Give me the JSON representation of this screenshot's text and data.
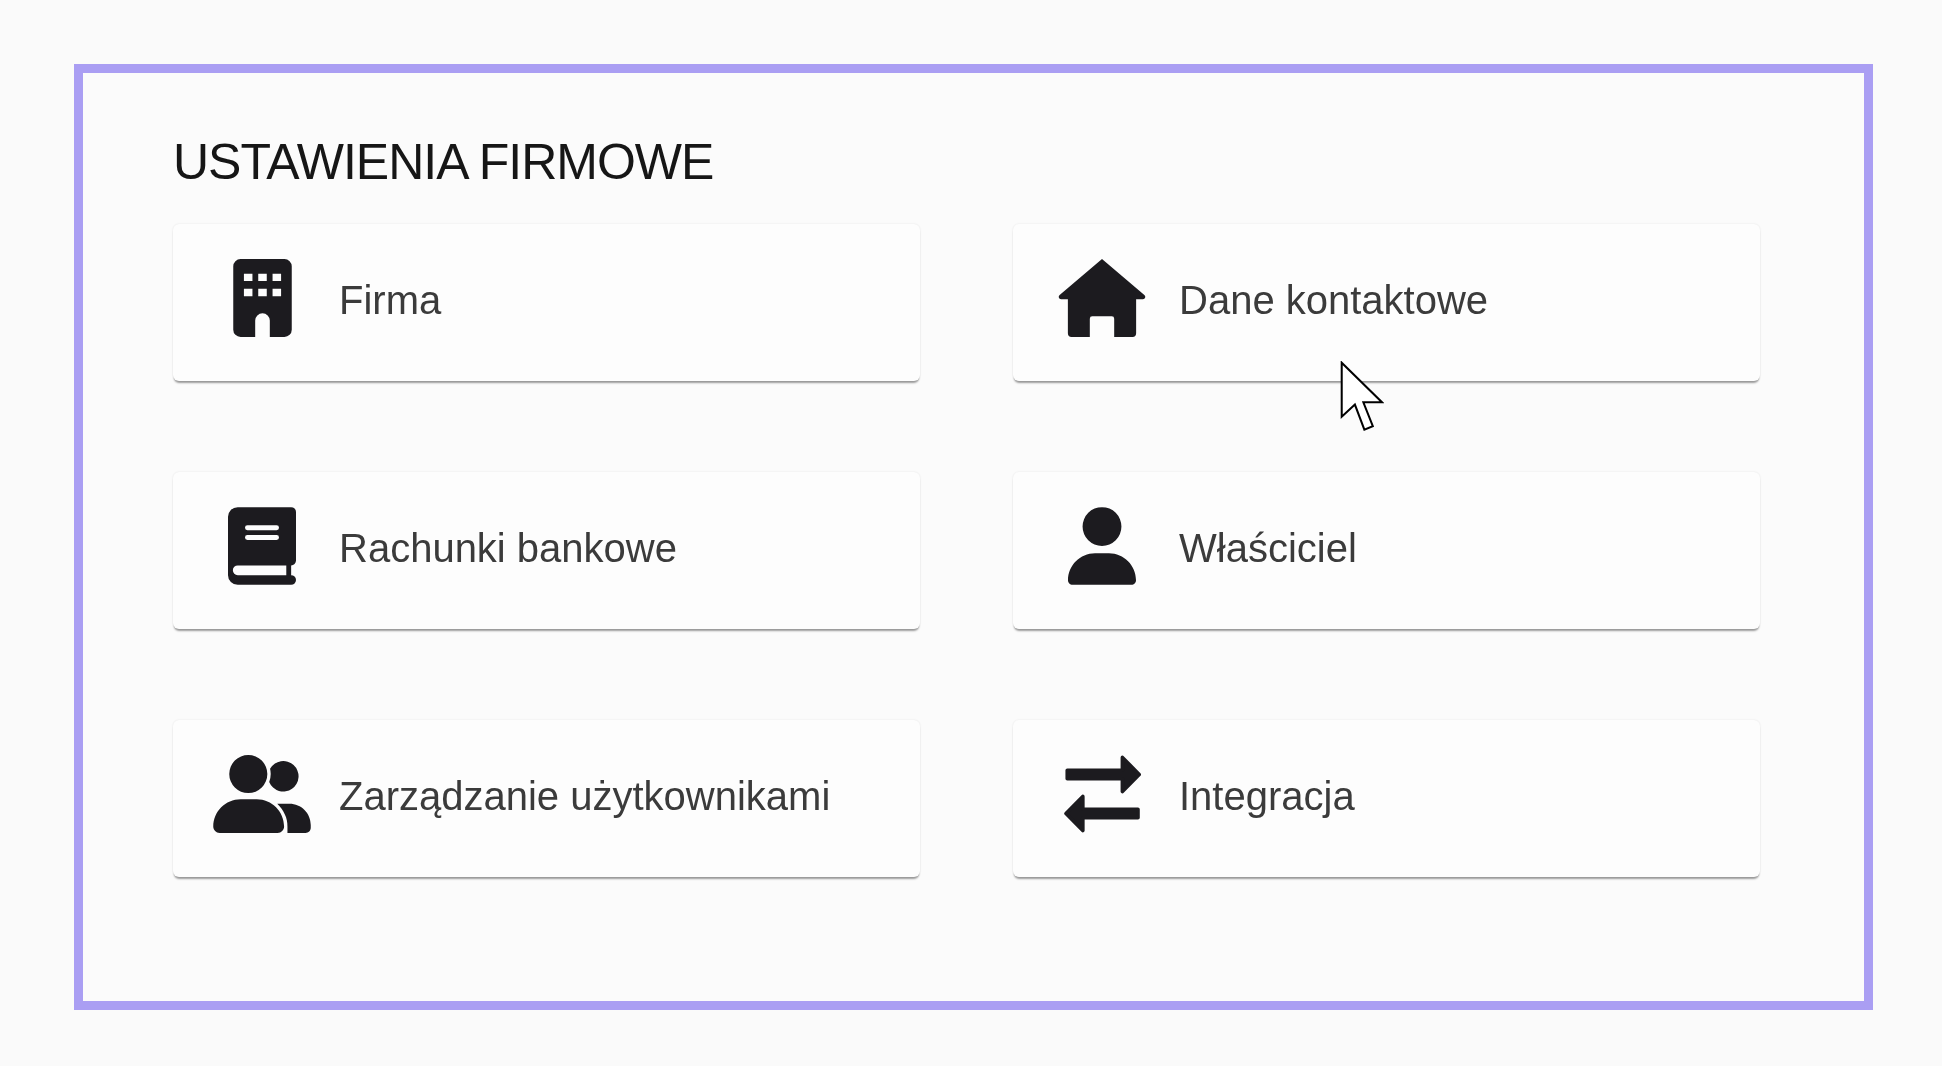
{
  "section": {
    "title": "USTAWIENIA FIRMOWE"
  },
  "tiles": [
    {
      "label": "Firma"
    },
    {
      "label": "Dane kontaktowe"
    },
    {
      "label": "Rachunki bankowe"
    },
    {
      "label": "Właściciel"
    },
    {
      "label": "Zarządzanie użytkownikami"
    },
    {
      "label": "Integracja"
    }
  ]
}
